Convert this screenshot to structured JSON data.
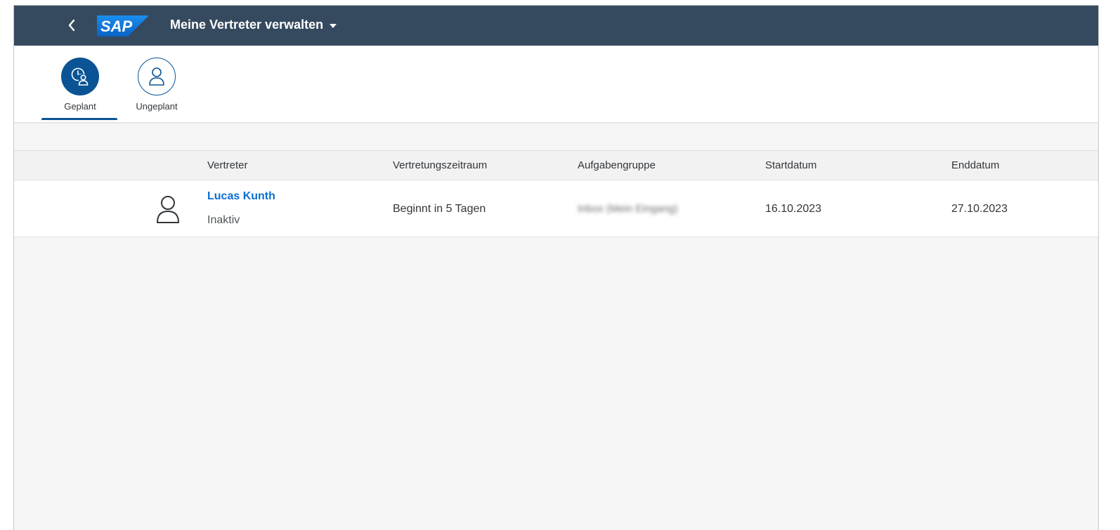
{
  "shell": {
    "logo_text": "SAP",
    "title": "Meine Vertreter verwalten",
    "colors": {
      "shell_bg": "#354a5f",
      "logo_blue": "#0a73d9"
    }
  },
  "tabs": [
    {
      "label": "Geplant",
      "icon": "calendar-person-icon",
      "selected": true
    },
    {
      "label": "Ungeplant",
      "icon": "person-icon",
      "selected": false
    }
  ],
  "table": {
    "columns": [
      "Vertreter",
      "Vertretungszeitraum",
      "Aufgabengruppe",
      "Startdatum",
      "Enddatum"
    ],
    "rows": [
      {
        "icon": "person-icon",
        "name": "Lucas Kunth",
        "status": "Inaktiv",
        "period": "Beginnt in 5 Tagen",
        "task_group": "Inbox (Mein Eingang)",
        "start": "16.10.2023",
        "end": "27.10.2023"
      }
    ]
  },
  "colors": {
    "accent": "#0a5496",
    "link": "#0a6ed1",
    "background": "#f5f5f5"
  }
}
